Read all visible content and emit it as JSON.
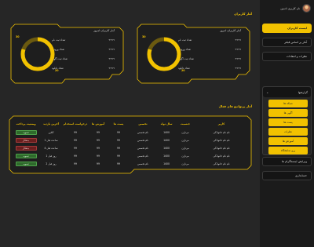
{
  "sidebar": {
    "profile_name": "نام کاربری ادمین",
    "items": [
      {
        "label": "لیست کاربران",
        "active": true
      },
      {
        "label": "آمار پر اساس فیلتر",
        "active": false
      },
      {
        "label": "نظرات و انتقادات",
        "active": false
      }
    ],
    "submenu": {
      "title": "گزارشها",
      "items": [
        "شبکه ها",
        "آگهی ها",
        "پست ها",
        "نظرات",
        "آموزش ها",
        "رزو نمایشگاه"
      ]
    },
    "bottom_items": [
      "ویرایش اینستاگرام ها",
      "حسابداری"
    ]
  },
  "main": {
    "users_title": "آمار کاربران",
    "cards": [
      {
        "title": "آمار کاربران امروز",
        "rows": [
          {
            "label": "تعداد ثبت نام",
            "value": "۹۹۹۹"
          },
          {
            "label": "تعداد ورودی",
            "value": "۹۹۹۹"
          },
          {
            "label": "تعداد ثبت آگهی",
            "value": "۹۹۹۹"
          },
          {
            "label": "تعداد دانلود",
            "value": "۹۹۹۹"
          }
        ],
        "donut_left": "20",
        "donut_right": "30",
        "donut_fraction": 0.8
      },
      {
        "title": "آمار کاربران امروز",
        "rows": [
          {
            "label": "تعداد ثبت نام",
            "value": "۹۹۹۹"
          },
          {
            "label": "تعداد ورودی",
            "value": "۹۹۹۹"
          },
          {
            "label": "تعداد ثبت آگهی",
            "value": "۹۹۹۹"
          },
          {
            "label": "تعداد دانلود",
            "value": "۹۹۹۹"
          }
        ],
        "donut_left": "20",
        "donut_right": "30",
        "donut_fraction": 0.8
      }
    ],
    "table_title": "آمار پرتوانیو های فعال",
    "table": {
      "headers": [
        "کاربر",
        "جنسیت",
        "سال تولد",
        "تخصص",
        "پست ها",
        "آموزش ها",
        "درخواست استخدام",
        "آخرین بازدید",
        "وضعیت پرداخت"
      ],
      "rows": [
        {
          "user": "نام نام خانوادگی",
          "gender": "مرد/زن",
          "birth": "1400",
          "spec": "نام تخصص",
          "posts": "99",
          "edu": "99",
          "hire": "99",
          "last": "آنلاین",
          "status": "تسویه",
          "ok": true
        },
        {
          "user": "نام نام خانوادگی",
          "gender": "مرد/زن",
          "birth": "1400",
          "spec": "نام تخصص",
          "posts": "99",
          "edu": "99",
          "hire": "99",
          "last": "1 ساعت قبل",
          "status": "بدهکار",
          "ok": false
        },
        {
          "user": "نام نام خانوادگی",
          "gender": "مرد/زن",
          "birth": "1400",
          "spec": "نام تخصص",
          "posts": "99",
          "edu": "99",
          "hire": "99",
          "last": "4 ساعت قبل",
          "status": "بدهکار",
          "ok": false
        },
        {
          "user": "نام نام خانوادگی",
          "gender": "مرد/زن",
          "birth": "1400",
          "spec": "نام تخصص",
          "posts": "99",
          "edu": "99",
          "hire": "99",
          "last": "1 روز قبل",
          "status": "تسویه",
          "ok": true
        },
        {
          "user": "نام نام خانوادگی",
          "gender": "مرد/زن",
          "birth": "1400",
          "spec": "نام تخصص",
          "posts": "99",
          "edu": "99",
          "hire": "99",
          "last": "2 روز قبل",
          "status": "تسویه",
          "ok": true
        }
      ]
    }
  },
  "colors": {
    "accent": "#f2c200",
    "ok": "#2f6a2c",
    "bad": "#6a1f1f"
  }
}
